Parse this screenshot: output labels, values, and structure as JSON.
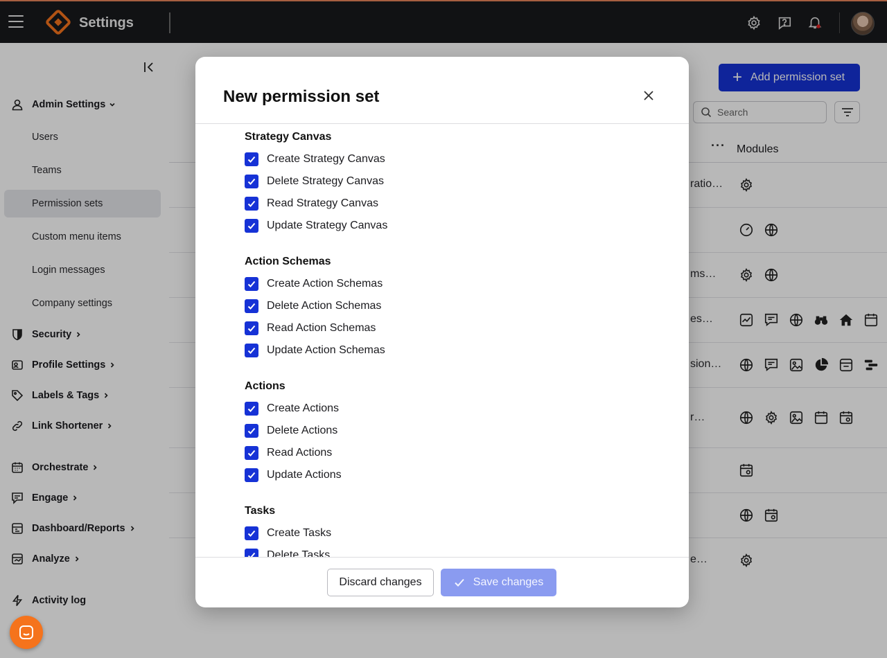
{
  "app": {
    "title": "Settings",
    "accent_color": "#1632d6",
    "brand_color": "#f5731c"
  },
  "topbar": {
    "icons": [
      "settings-icon",
      "help-icon",
      "notifications-icon"
    ],
    "has_notification_dot": true
  },
  "sidebar": {
    "groups": [
      {
        "label": "Admin Settings",
        "icon": "user-icon",
        "expanded": true
      },
      {
        "label": "Security",
        "icon": "shield-icon"
      },
      {
        "label": "Profile Settings",
        "icon": "profile-icon"
      },
      {
        "label": "Labels & Tags",
        "icon": "tag-icon"
      },
      {
        "label": "Link Shortener",
        "icon": "link-icon"
      },
      {
        "label": "Orchestrate",
        "icon": "calendar-icon"
      },
      {
        "label": "Engage",
        "icon": "chat-icon"
      },
      {
        "label": "Dashboard/Reports",
        "icon": "dashboard-icon"
      },
      {
        "label": "Analyze",
        "icon": "analyze-icon"
      },
      {
        "label": "Activity log",
        "icon": "bolt-icon"
      }
    ],
    "admin_items": [
      {
        "label": "Users"
      },
      {
        "label": "Teams"
      },
      {
        "label": "Permission sets",
        "active": true
      },
      {
        "label": "Custom menu items"
      },
      {
        "label": "Login messages"
      },
      {
        "label": "Company settings"
      }
    ]
  },
  "background": {
    "add_button_label": "Add permission set",
    "search_placeholder": "Search",
    "column_header": "Modules",
    "row_fragments": [
      "ratio…",
      "",
      "ms…",
      "es…",
      "sion…",
      "r…",
      "",
      "",
      "e…"
    ]
  },
  "modal": {
    "title": "New permission set",
    "sections": [
      {
        "title": "Strategy Canvas",
        "items": [
          "Create Strategy Canvas",
          "Delete Strategy Canvas",
          "Read Strategy Canvas",
          "Update Strategy Canvas"
        ]
      },
      {
        "title": "Action Schemas",
        "items": [
          "Create Action Schemas",
          "Delete Action Schemas",
          "Read Action Schemas",
          "Update Action Schemas"
        ]
      },
      {
        "title": "Actions",
        "items": [
          "Create Actions",
          "Delete Actions",
          "Read Actions",
          "Update Actions"
        ]
      },
      {
        "title": "Tasks",
        "items": [
          "Create Tasks",
          "Delete Tasks"
        ]
      }
    ],
    "discard_label": "Discard changes",
    "save_label": "Save changes",
    "all_checked": true
  }
}
